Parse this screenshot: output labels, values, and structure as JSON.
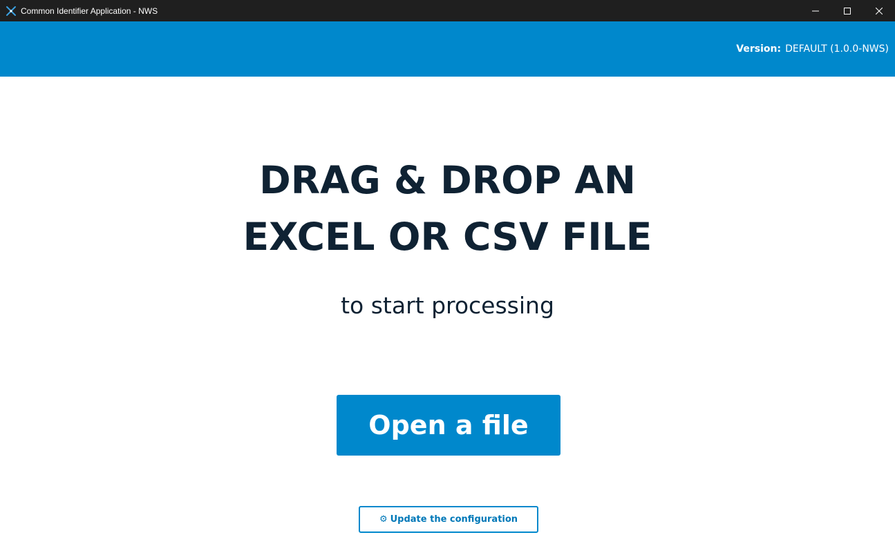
{
  "window": {
    "title": "Common Identifier Application - NWS",
    "icon": "app-x-icon",
    "controls": [
      "minimize-icon",
      "maximize-icon",
      "close-icon"
    ]
  },
  "header": {
    "version_label": "Version:",
    "version_value": "DEFAULT (1.0.0-NWS)"
  },
  "main": {
    "headline_line1": "DRAG & DROP AN",
    "headline_line2": "EXCEL OR CSV FILE",
    "subhead": "to start processing",
    "open_button_label": "Open a file",
    "config_button_icon": "⚙",
    "config_button_label": "Update the configuration"
  },
  "colors": {
    "titlebar": "#1f1f1f",
    "accent": "#0088cc",
    "headline_text": "#0f2233"
  }
}
